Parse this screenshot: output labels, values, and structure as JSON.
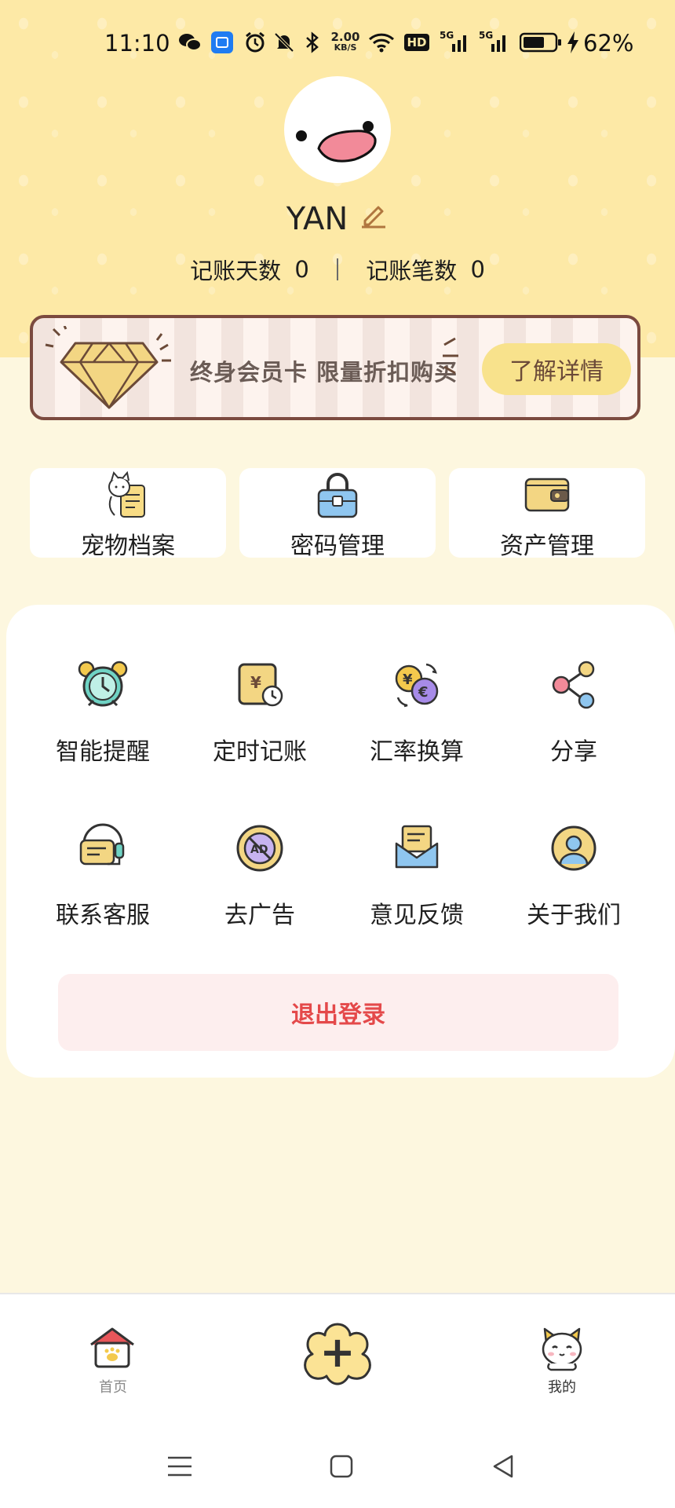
{
  "status_bar": {
    "time": "11:10",
    "net_speed_value": "2.00",
    "net_speed_unit": "KB/S",
    "hd_label": "HD",
    "signal_label_1": "5G",
    "signal_label_2": "5G",
    "battery": "62%",
    "icons": [
      "wechat-icon",
      "app-notification-icon",
      "alarm-icon",
      "mute-icon",
      "bluetooth-icon",
      "wifi-icon",
      "hd-icon",
      "signal-5g-icon",
      "signal-5g-icon",
      "battery-icon",
      "charging-icon"
    ]
  },
  "profile": {
    "username": "YAN",
    "stats": {
      "days_label": "记账天数",
      "days_value": "0",
      "records_label": "记账笔数",
      "records_value": "0"
    }
  },
  "vip_banner": {
    "text": "终身会员卡 限量折扣购买",
    "button": "了解详情"
  },
  "quick_cards": [
    {
      "label": "宠物档案",
      "icon": "pet-file-icon"
    },
    {
      "label": "密码管理",
      "icon": "lock-icon"
    },
    {
      "label": "资产管理",
      "icon": "wallet-icon"
    }
  ],
  "grid_items": [
    {
      "label": "智能提醒",
      "icon": "alarm-clock-icon"
    },
    {
      "label": "定时记账",
      "icon": "scheduled-bill-icon"
    },
    {
      "label": "汇率换算",
      "icon": "currency-exchange-icon"
    },
    {
      "label": "分享",
      "icon": "share-icon"
    },
    {
      "label": "联系客服",
      "icon": "customer-service-icon"
    },
    {
      "label": "去广告",
      "icon": "no-ads-icon"
    },
    {
      "label": "意见反馈",
      "icon": "feedback-icon"
    },
    {
      "label": "关于我们",
      "icon": "about-us-icon"
    }
  ],
  "no_ads_icon_text": "AD",
  "currency_symbols": {
    "yen": "¥",
    "euro": "€"
  },
  "logout_label": "退出登录",
  "tabbar": {
    "home_label": "首页",
    "add_symbol": "+",
    "mine_label": "我的"
  },
  "colors": {
    "header_yellow": "#fde9a6",
    "page_bg": "#fdf7df",
    "logout_red": "#e4494a",
    "vip_border": "#7b4a3f",
    "vip_button": "#f8e28c"
  }
}
